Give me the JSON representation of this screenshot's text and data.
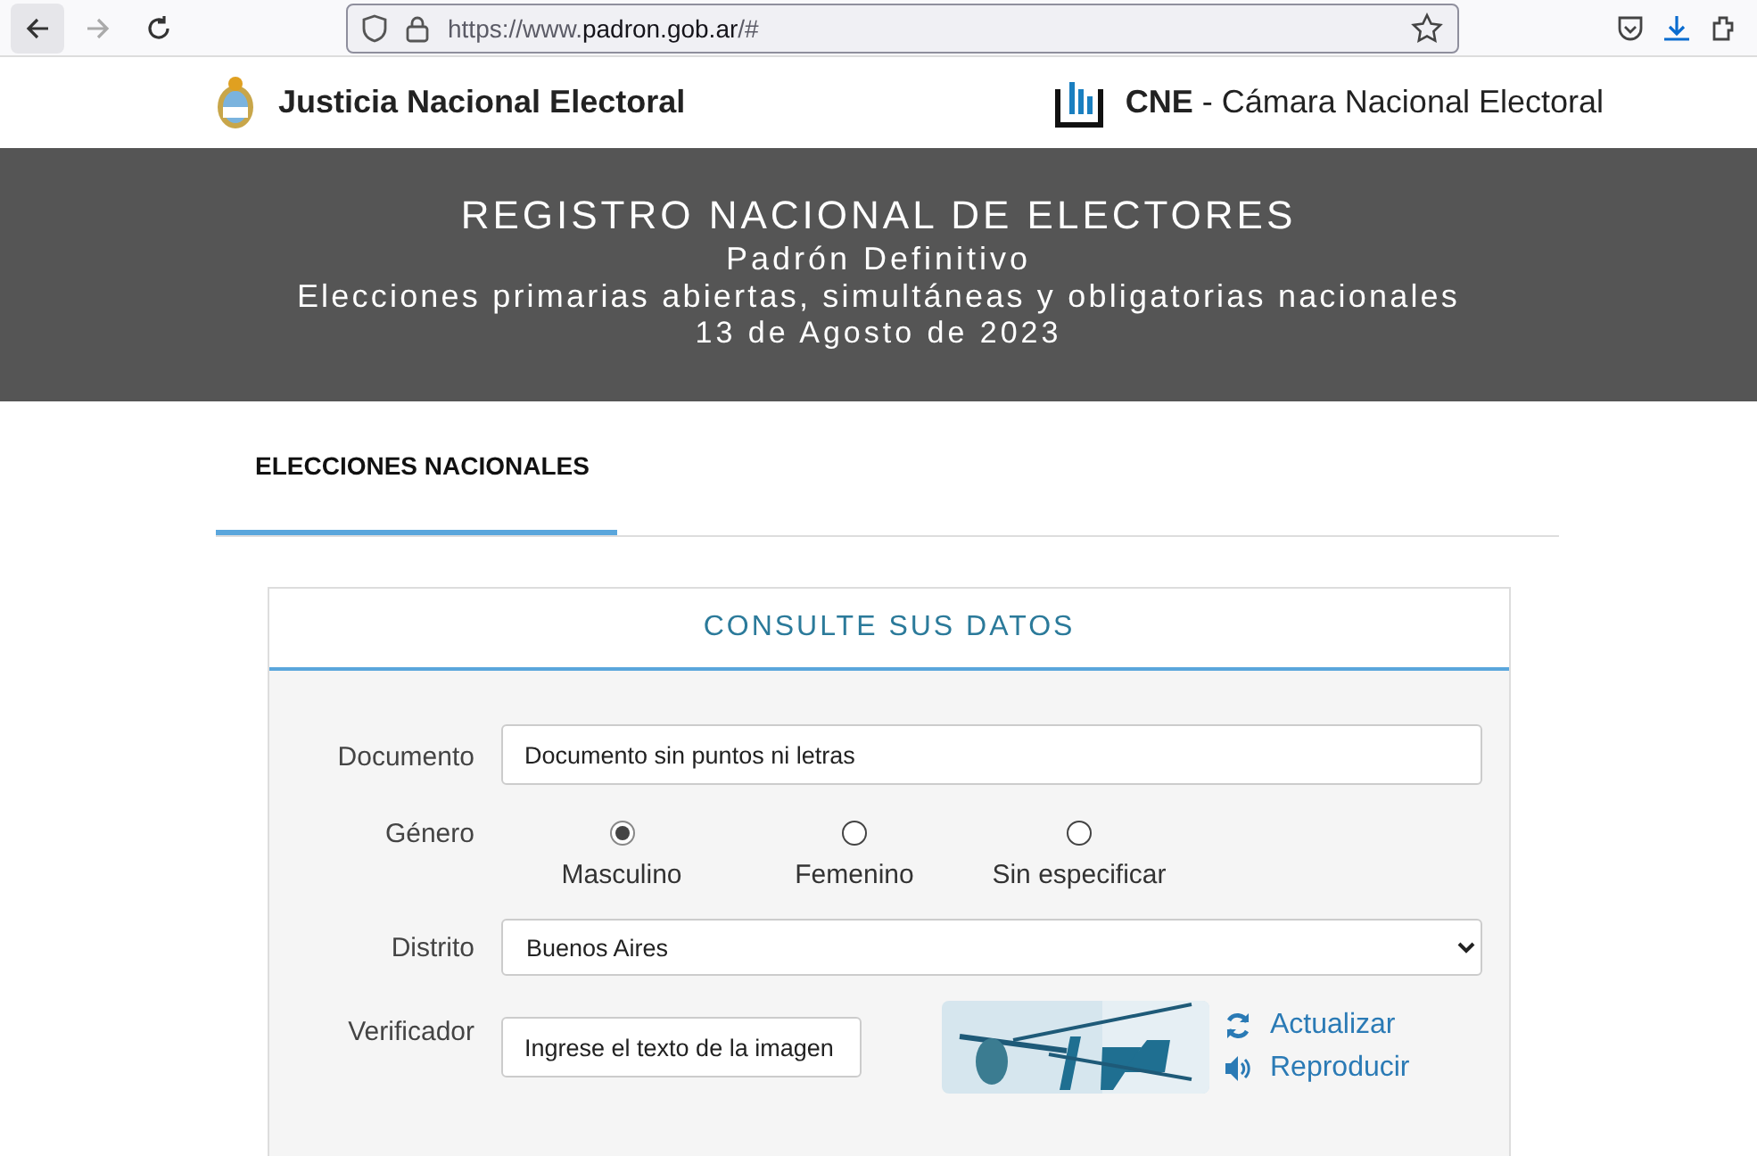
{
  "browser": {
    "url_prefix": "https://www.",
    "url_domain": "padron.gob.ar",
    "url_suffix": "/#"
  },
  "header": {
    "left_title": "Justicia Nacional Electoral",
    "right_abbr": "CNE",
    "right_title": " - Cámara Nacional Electoral"
  },
  "banner": {
    "lines": [
      "REGISTRO NACIONAL DE ELECTORES",
      "Padrón Definitivo",
      "Elecciones primarias abiertas, simultáneas y obligatorias nacionales",
      "13 de Agosto de 2023"
    ]
  },
  "tabs": [
    {
      "label": "ELECCIONES NACIONALES",
      "selected": true
    }
  ],
  "form": {
    "title": "CONSULTE SUS DATOS",
    "document": {
      "label": "Documento",
      "placeholder": "Documento sin puntos ni letras"
    },
    "gender": {
      "label": "Género",
      "options": [
        {
          "label": "Masculino",
          "selected": true
        },
        {
          "label": "Femenino",
          "selected": false
        },
        {
          "label": "Sin especificar",
          "selected": false
        }
      ]
    },
    "district": {
      "label": "Distrito",
      "value": "Buenos Aires"
    },
    "verifier": {
      "label": "Verificador",
      "placeholder": "Ingrese el texto de la imagen",
      "captcha": {
        "kind": "picture"
      },
      "links": [
        "Actualizar",
        "Reproducir"
      ]
    }
  }
}
